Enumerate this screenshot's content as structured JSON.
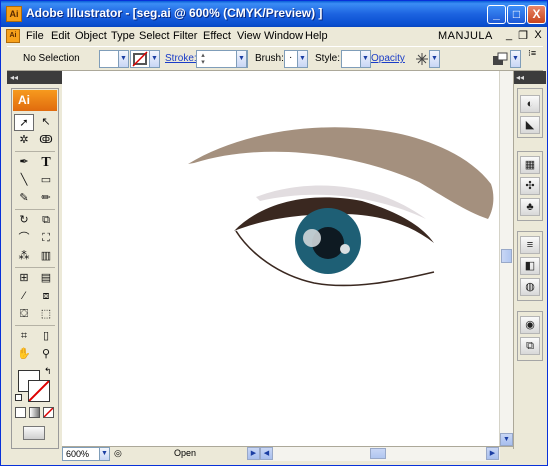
{
  "window": {
    "title": "Adobe Illustrator - [seg.ai @ 600% (CMYK/Preview) ]",
    "app_icon_text": "Ai",
    "buttons": [
      "_",
      "□",
      "X"
    ]
  },
  "menubar": {
    "items": [
      "File",
      "Edit",
      "Object",
      "Type",
      "Select",
      "Filter",
      "Effect",
      "View",
      "Window",
      "Help"
    ],
    "user": "MANJULA",
    "mdi_buttons": [
      "_",
      "❐",
      "X"
    ]
  },
  "controlbar": {
    "selection": "No Selection",
    "stroke_label": "Stroke:",
    "brush_label": "Brush:",
    "style_label": "Style:",
    "opacity_label": "Opacity"
  },
  "toolbox": {
    "badge": "Ai",
    "collapse_glyph": "◂◂"
  },
  "statusbar": {
    "zoom": "600%",
    "status": "Open"
  },
  "artwork": {
    "brow_color": "#a4907e",
    "iris_color": "#1e5f75",
    "pupil_color": "#0e1a22",
    "lid_color": "#3a2820",
    "shadow_color": "#e2dde0"
  }
}
